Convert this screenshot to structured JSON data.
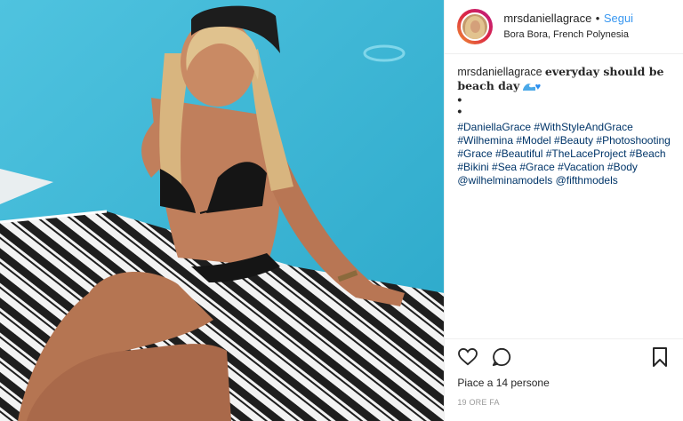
{
  "post": {
    "username": "mrsdaniellagrace",
    "separator": "•",
    "follow_label": "Segui",
    "location": "Bora Bora, French Polynesia",
    "caption": {
      "username": "mrsdaniellagrace",
      "text": "everyday should be beach day",
      "emoji": [
        "wave-icon",
        "blue-heart-icon"
      ],
      "bullets": [
        "•",
        "•"
      ],
      "hashtag_lines": [
        "#DaniellaGrace #WithStyleAndGrace",
        "#Wilhemina #Model #Beauty #Photoshooting",
        "#Grace #Beautiful #TheLaceProject #Beach",
        "#Bikini #Sea #Grace #Vacation #Body",
        "@wilhelminamodels @fifthmodels"
      ]
    },
    "likes_text": "Piace a 14 persone",
    "timestamp": "19 ORE FA",
    "icons": [
      "heart-icon",
      "comment-icon",
      "bookmark-icon"
    ],
    "colors": {
      "link": "#003569",
      "follow": "#3897f0",
      "pool": "#3bb7d6"
    }
  }
}
